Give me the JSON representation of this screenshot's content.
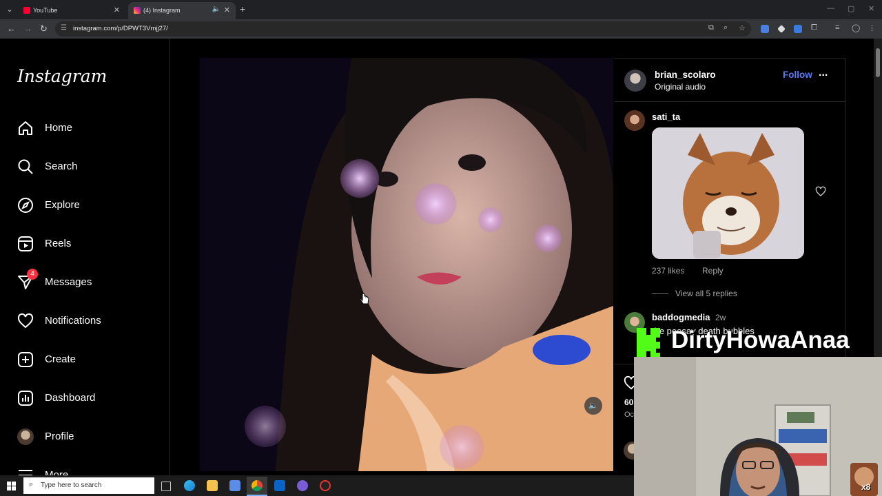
{
  "browser": {
    "tabs": [
      {
        "title": "YouTube",
        "active": false
      },
      {
        "title": "(4) Instagram",
        "active": true
      }
    ],
    "url": "instagram.com/p/DPWT3Vmjj27/"
  },
  "sidebar": {
    "logo": "Instagram",
    "items": [
      {
        "label": "Home",
        "icon": "home-icon"
      },
      {
        "label": "Search",
        "icon": "search-icon"
      },
      {
        "label": "Explore",
        "icon": "compass-icon"
      },
      {
        "label": "Reels",
        "icon": "reels-icon"
      },
      {
        "label": "Messages",
        "icon": "messages-icon",
        "badge": "4"
      },
      {
        "label": "Notifications",
        "icon": "heart-icon"
      },
      {
        "label": "Create",
        "icon": "plus-square-icon"
      },
      {
        "label": "Dashboard",
        "icon": "dashboard-icon"
      },
      {
        "label": "Profile",
        "icon": "avatar"
      },
      {
        "label": "More",
        "icon": "menu-icon"
      }
    ]
  },
  "post": {
    "author": "brian_scolaro",
    "audio": "Original audio",
    "follow_label": "Follow",
    "more_label": "..."
  },
  "comments": [
    {
      "user": "sati_ta",
      "likes": "237 likes",
      "reply_label": "Reply",
      "view_replies": "View all 5 replies"
    },
    {
      "user": "baddogmedia",
      "time": "2w",
      "text": "the poosay death bubbles"
    }
  ],
  "actions": {
    "likes_partial": "60",
    "date_partial": "Oc"
  },
  "overlay": {
    "channel_name": "DirtyHowaAnaa",
    "emote_count": "x8"
  },
  "taskbar": {
    "search_placeholder": "Type here to search"
  },
  "colors": {
    "follow": "#5a7bf5",
    "badge": "#ff3040",
    "kick_green": "#53fc18"
  }
}
